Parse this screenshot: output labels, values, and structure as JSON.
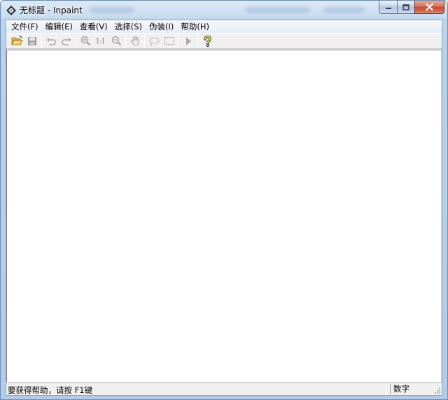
{
  "window": {
    "title": "无标题 - Inpaint"
  },
  "menu": {
    "items": [
      {
        "label": "文件(F)"
      },
      {
        "label": "编辑(E)"
      },
      {
        "label": "查看(V)"
      },
      {
        "label": "选择(S)"
      },
      {
        "label": "伪装(I)"
      },
      {
        "label": "帮助(H)"
      }
    ]
  },
  "toolbar": {
    "buttons": [
      {
        "icon": "open-folder-icon",
        "enabled": true
      },
      {
        "icon": "save-icon",
        "enabled": false
      },
      {
        "icon": "undo-icon",
        "enabled": false
      },
      {
        "icon": "redo-icon",
        "enabled": false
      },
      {
        "icon": "zoom-in-icon",
        "enabled": false
      },
      {
        "icon": "actual-size-icon",
        "enabled": false,
        "text": "1:1"
      },
      {
        "icon": "zoom-out-icon",
        "enabled": false
      },
      {
        "icon": "hand-pan-icon",
        "enabled": false
      },
      {
        "icon": "lasso-select-icon",
        "enabled": false
      },
      {
        "icon": "rect-select-icon",
        "enabled": false
      },
      {
        "icon": "run-play-icon",
        "enabled": false
      },
      {
        "icon": "help-icon",
        "enabled": true
      }
    ]
  },
  "status": {
    "message": "要获得帮助，请按 F1键",
    "num_lock": "数字"
  },
  "colors": {
    "window_frame": "#b3cbe7",
    "client_bg": "#f0f0f0",
    "canvas_bg": "#ffffff",
    "close_button": "#c44a30"
  }
}
